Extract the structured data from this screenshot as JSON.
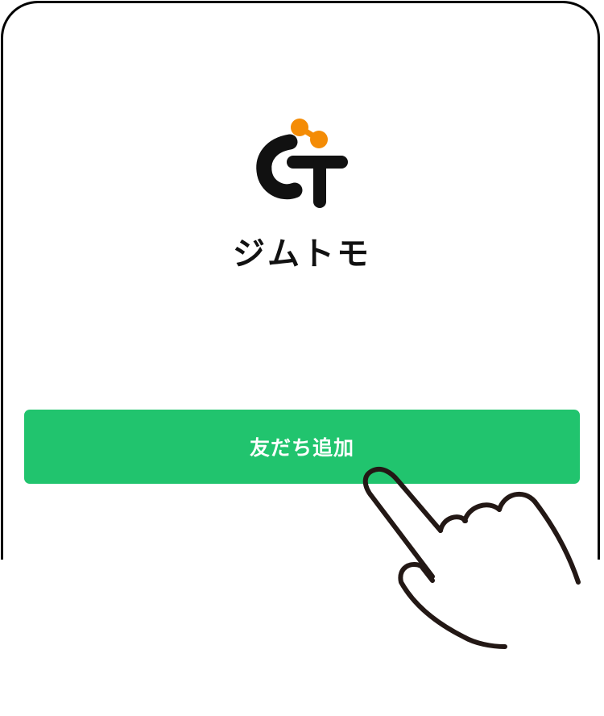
{
  "app": {
    "name": "ジムトモ",
    "logo_icon": "gymtomo-logo-icon"
  },
  "actions": {
    "add_friend_label": "友だち追加"
  },
  "gesture": {
    "icon": "tap-hand-icon"
  },
  "colors": {
    "button_green": "#21C46E",
    "logo_black": "#111111",
    "logo_accent_orange": "#F48C06",
    "frame_black": "#000000",
    "hand_stroke": "#231815"
  }
}
